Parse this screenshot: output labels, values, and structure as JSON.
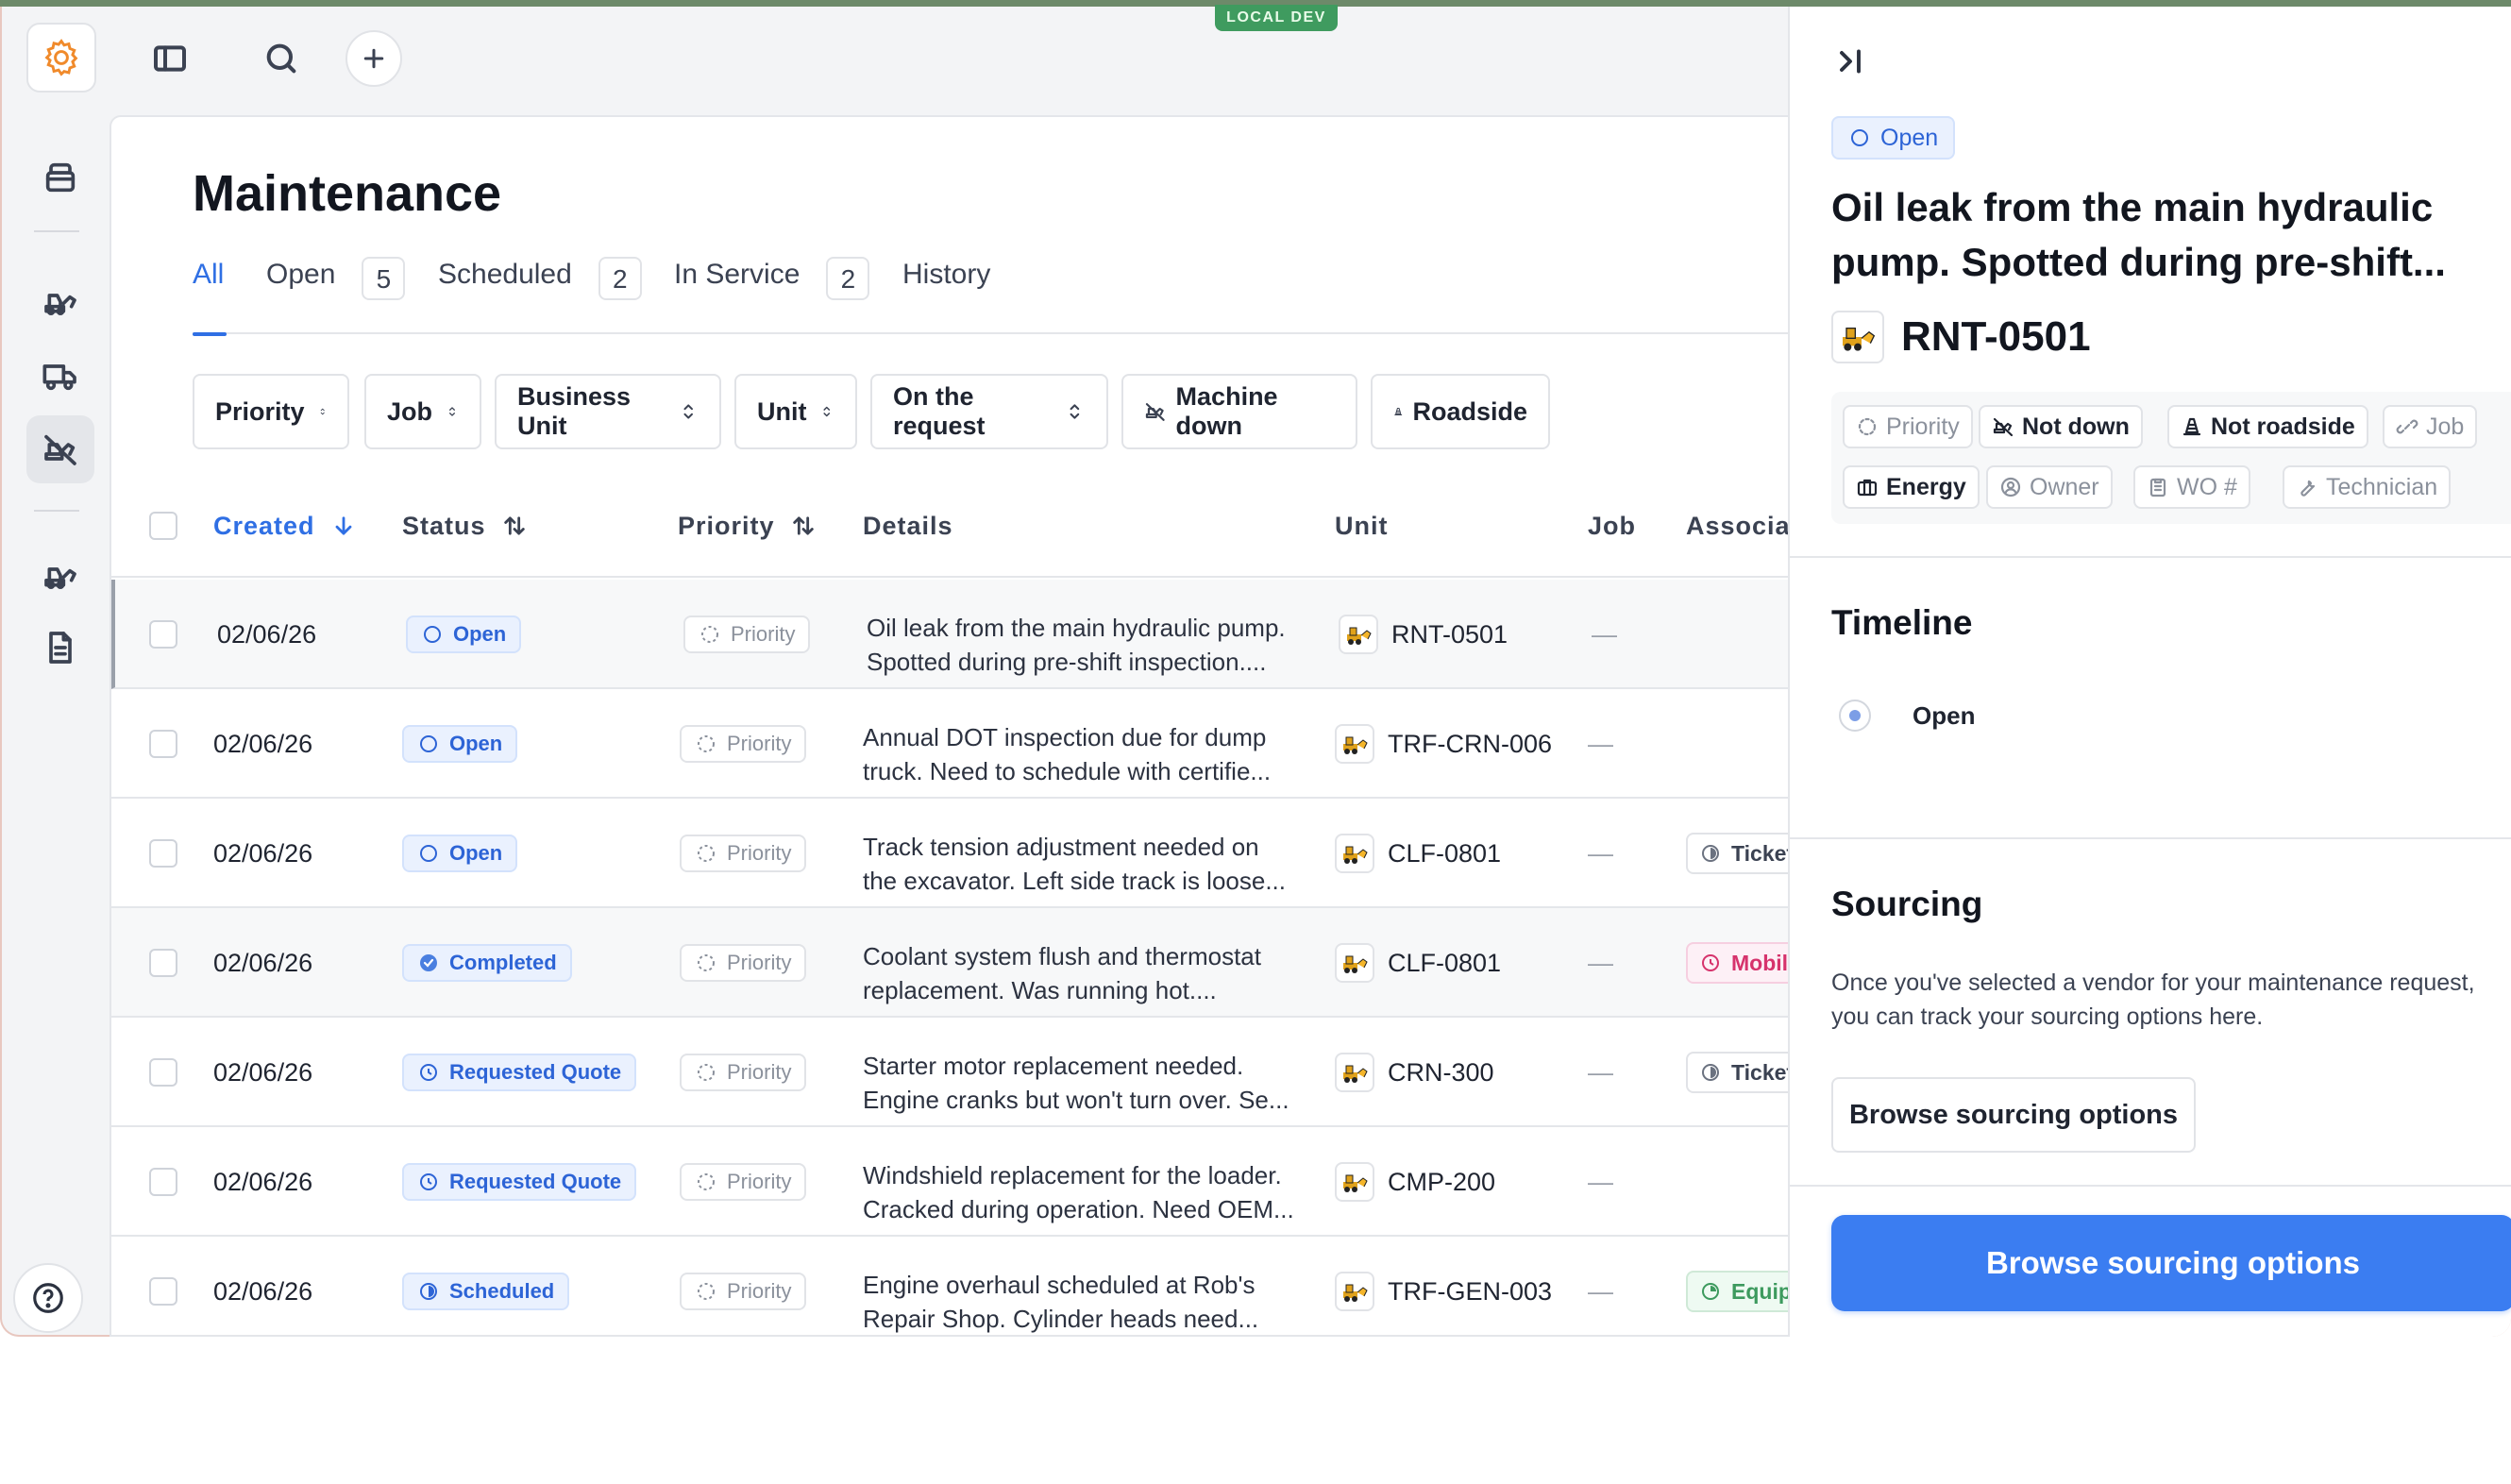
{
  "env_badge": "LOCAL DEV",
  "page": {
    "title": "Maintenance",
    "tabs": [
      {
        "label": "All",
        "count": ""
      },
      {
        "label": "Open",
        "count": "5"
      },
      {
        "label": "Scheduled",
        "count": "2"
      },
      {
        "label": "In Service",
        "count": "2"
      },
      {
        "label": "History",
        "count": ""
      }
    ],
    "filters": [
      "Priority",
      "Job",
      "Business Unit",
      "Unit",
      "On the request",
      "Machine down",
      "Roadside"
    ]
  },
  "table": {
    "columns": [
      "Created",
      "Status",
      "Priority",
      "Details",
      "Unit",
      "Job",
      "Associat"
    ],
    "rows": [
      {
        "created": "02/06/26",
        "status": "Open",
        "priority": "Priority",
        "details": "Oil leak from the main hydraulic pump.\nSpotted during pre-shift inspection....",
        "unit": "RNT-0501",
        "job": "—",
        "assoc": ""
      },
      {
        "created": "02/06/26",
        "status": "Open",
        "priority": "Priority",
        "details": "Annual DOT inspection due for dump\ntruck. Need to schedule with certifie...",
        "unit": "TRF-CRN-006",
        "job": "—",
        "assoc": ""
      },
      {
        "created": "02/06/26",
        "status": "Open",
        "priority": "Priority",
        "details": "Track tension adjustment needed on\nthe excavator. Left side track is loose...",
        "unit": "CLF-0801",
        "job": "—",
        "assoc": "Ticket"
      },
      {
        "created": "02/06/26",
        "status": "Completed",
        "priority": "Priority",
        "details": "Coolant system flush and thermostat\nreplacement. Was running hot....",
        "unit": "CLF-0801",
        "job": "—",
        "assoc": "Mobili"
      },
      {
        "created": "02/06/26",
        "status": "Requested Quote",
        "priority": "Priority",
        "details": "Starter motor replacement needed.\nEngine cranks but won't turn over. Se...",
        "unit": "CRN-300",
        "job": "—",
        "assoc": "Ticket"
      },
      {
        "created": "02/06/26",
        "status": "Requested Quote",
        "priority": "Priority",
        "details": "Windshield replacement for the loader.\nCracked during operation. Need OEM...",
        "unit": "CMP-200",
        "job": "—",
        "assoc": ""
      },
      {
        "created": "02/06/26",
        "status": "Scheduled",
        "priority": "Priority",
        "details": "Engine overhaul scheduled at Rob's\nRepair Shop. Cylinder heads need...",
        "unit": "TRF-GEN-003",
        "job": "—",
        "assoc": "Equip"
      }
    ]
  },
  "detail": {
    "status": "Open",
    "title": "Oil leak from the main hydraulic pump. Spotted during pre-shift...",
    "unit": "RNT-0501",
    "tags": [
      "Priority",
      "Not down",
      "Not roadside",
      "Job",
      "Energy",
      "Owner",
      "WO #",
      "Technician"
    ],
    "timeline_title": "Timeline",
    "timeline_item": "Open",
    "sourcing_title": "Sourcing",
    "sourcing_desc": "Once you've selected a vendor for your maintenance request, you can track your sourcing options here.",
    "sourcing_button": "Browse sourcing options",
    "primary_button": "Browse sourcing options"
  },
  "colors": {
    "accent": "#2f6fe4",
    "primary_button": "#3b7df1",
    "env_badge": "#3f9b5f"
  }
}
